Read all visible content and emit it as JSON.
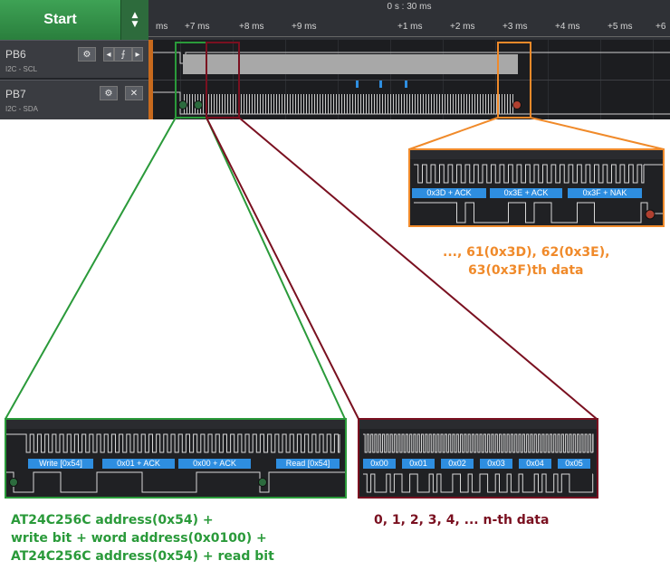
{
  "toolbar": {
    "start_label": "Start",
    "up_arrow": "▲",
    "down_arrow": "▼"
  },
  "timeline": {
    "center_time": "0 s : 30 ms",
    "ticks": [
      "ms",
      "+7 ms",
      "+8 ms",
      "+9 ms",
      "+1 ms",
      "+2 ms",
      "+3 ms",
      "+4 ms",
      "+5 ms",
      "+6"
    ]
  },
  "channels": [
    {
      "name": "PB6",
      "subtitle": "I2C - SCL",
      "icons": [
        "gear-icon",
        "arrow-left-icon",
        "edge-trigger-icon",
        "arrow-right-icon"
      ]
    },
    {
      "name": "PB7",
      "subtitle": "I2C - SDA",
      "icons": [
        "gear-icon",
        "close-icon"
      ]
    }
  ],
  "zoom_green": {
    "labels": [
      "Write [0x54]",
      "0x01 + ACK",
      "0x00 + ACK",
      "Read [0x54]"
    ],
    "caption": [
      "AT24C256C address(0x54) +",
      "write bit + word address(0x0100) +",
      "AT24C256C address(0x54) + read bit"
    ]
  },
  "zoom_red": {
    "labels": [
      "0x00",
      "0x01",
      "0x02",
      "0x03",
      "0x04",
      "0x05"
    ],
    "caption": "0, 1, 2, 3, 4, ... n-th data"
  },
  "zoom_orange": {
    "labels": [
      "0x3D + ACK",
      "0x3E + ACK",
      "0x3F + NAK"
    ],
    "caption": [
      "..., 61(0x3D), 62(0x3E),",
      "63(0x3F)th data"
    ]
  },
  "colors": {
    "green": "#2a9a3a",
    "red": "#7a1020",
    "orange": "#f08a2a",
    "label_blue": "#2e8ee0",
    "start_green": "#3ea255"
  }
}
